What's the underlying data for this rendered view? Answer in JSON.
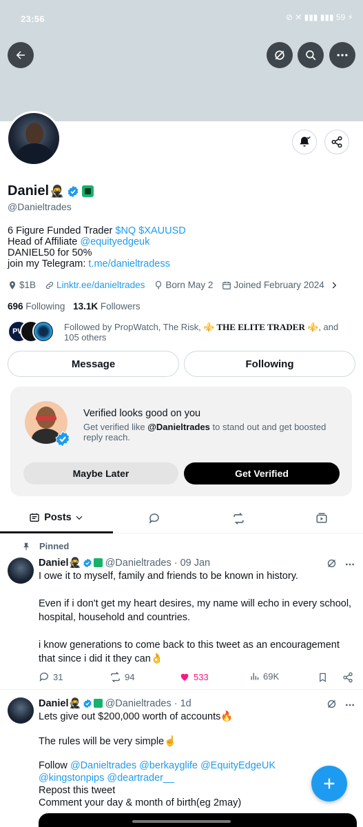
{
  "status_bar": {
    "time": "23:56",
    "icons": "⊘ ✕ ▮▮▮ ▮▮▮ 59 ⚡"
  },
  "profile": {
    "name": "Daniel",
    "name_emoji": "🥷",
    "handle": "@Danieltrades",
    "bio": {
      "line1_text": "6 Figure Funded Trader ",
      "line1_link": "$NQ $XAUUSD",
      "line2_text": "Head of Affiliate ",
      "line2_link": "@equityedgeuk",
      "line3_text": "DANIEL50 for 50%",
      "line4_text": "join my Telegram: ",
      "line4_link": "t.me/danieltradess"
    },
    "meta": {
      "location": "$1B",
      "website": "Linktr.ee/danieltrades",
      "born": "Born May 2",
      "joined": "Joined February 2024"
    },
    "following_count": "696",
    "following_label": "Following",
    "followers_count": "13.1K",
    "followers_label": "Followers",
    "followed_by_prefix": "Followed by PropWatch, The Risk, ",
    "followed_by_elite": "⚜️ THE ELITE TRADER ⚜️",
    "followed_by_suffix": ", and 105 others",
    "message_label": "Message",
    "following_button_label": "Following"
  },
  "verified_card": {
    "title": "Verified looks good on you",
    "desc_prefix": "Get verified like ",
    "desc_handle": "@Danieltrades",
    "desc_suffix": " to stand out and get boosted reply reach.",
    "maybe_later": "Maybe Later",
    "get_verified": "Get Verified"
  },
  "tabs": {
    "posts_label": "Posts"
  },
  "pinned_label": "Pinned",
  "tweets": [
    {
      "name": "Daniel",
      "emoji": "🥷",
      "handle": "@Danieltrades",
      "time": "· 09 Jan",
      "p1": "I owe it to myself, family and friends to be known in history.",
      "p2": "Even if i don't get my heart desires, my name will echo in every school, hospital, household and countries.",
      "p3": "i know generations to come back to this tweet as an encouragement that since i did it they can👌",
      "replies": "31",
      "reposts": "94",
      "likes": "533",
      "views": "69K"
    },
    {
      "name": "Daniel",
      "emoji": "🥷",
      "handle": "@Danieltrades",
      "time": "· 1d",
      "p1": "Lets give out $200,000 worth of accounts🔥",
      "p2": "The rules will be very simple☝️",
      "p3_prefix": "Follow ",
      "p3_mentions": "@Danieltrades @berkayglife @EquityEdgeUK @kingstonpips @deartrader__",
      "p4": "Repost this tweet",
      "p5": "Comment your day & month of birth(eg 2may)"
    }
  ],
  "colors": {
    "accent": "#1d9bf0",
    "like": "#f91880",
    "text": "#0f1419",
    "muted": "#536471",
    "banner": "#cfd9de"
  }
}
